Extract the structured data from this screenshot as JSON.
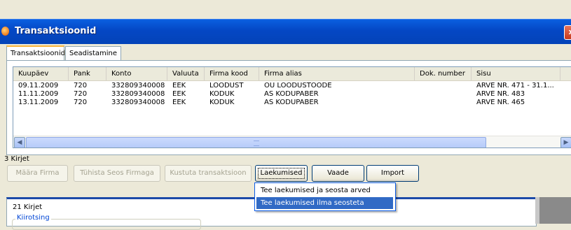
{
  "window": {
    "title": "Transaktsioonid",
    "close_glyph": "x"
  },
  "tabs": [
    {
      "label": "Transaktsioonid"
    },
    {
      "label": "Seadistamine"
    }
  ],
  "table": {
    "columns": [
      "Kuupäev",
      "Pank",
      "Konto",
      "Valuuta",
      "Firma kood",
      "Firma alias",
      "Dok. number",
      "Sisu"
    ],
    "rows": [
      [
        "09.11.2009",
        "720",
        "332809340008",
        "EEK",
        "LOODUST",
        "OÜ LOODUSTOODE",
        "",
        "ARVE NR. 471 - 31.1..."
      ],
      [
        "11.11.2009",
        "720",
        "332809340008",
        "EEK",
        "KODUK",
        "AS KODUPABER",
        "",
        "ARVE NR. 483"
      ],
      [
        "13.11.2009",
        "720",
        "332809340008",
        "EEK",
        "KODUK",
        "AS KODUPABER",
        "",
        "ARVE NR. 465"
      ]
    ]
  },
  "status": {
    "count": "3 Kirjet"
  },
  "buttons": {
    "maara_firma": "Määra Firma",
    "tuhista_seos": "Tühista Seos Firmaga",
    "kustuta": "Kustuta transaktsioon",
    "laekumised": "Laekumised",
    "vaade": "Vaade",
    "import": "Import"
  },
  "dropdown": {
    "items": [
      "Tee laekumised ja seosta arved",
      "Tee laekumised ilma seosteta"
    ]
  },
  "lower": {
    "count": "21 Kirjet",
    "legend": "Kiirotsing"
  },
  "icons": {
    "scroll_left": "◀",
    "scroll_right": "▶",
    "app": "app-icon"
  }
}
